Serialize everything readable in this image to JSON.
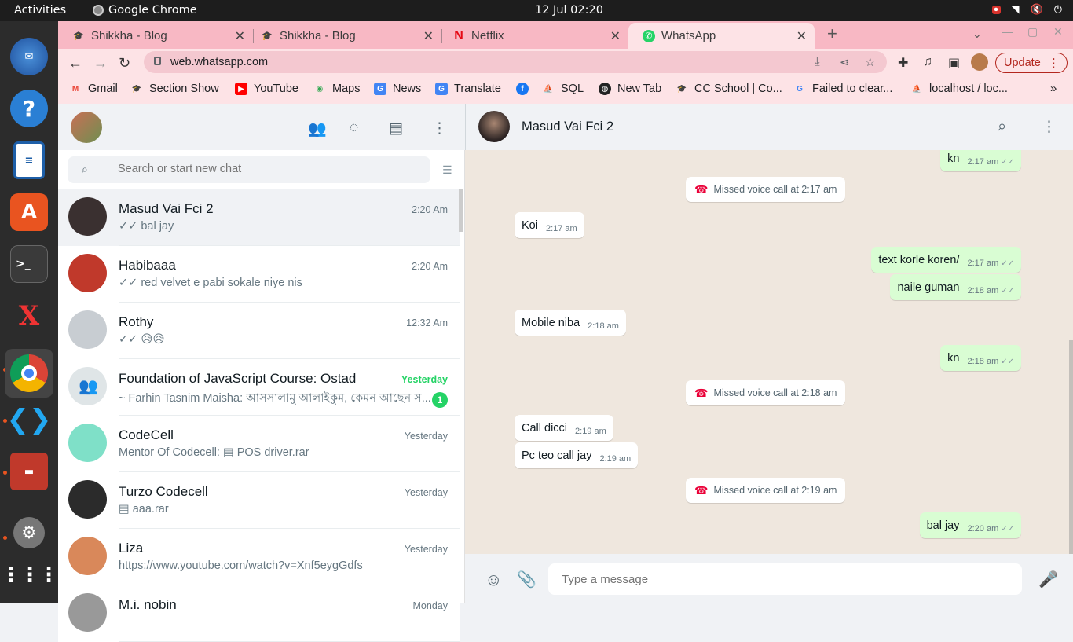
{
  "system": {
    "activities": "Activities",
    "app_name": "Google Chrome",
    "clock": "12 Jul  02:20"
  },
  "browser": {
    "tabs": [
      {
        "title": "Shikkha - Blog",
        "icon": "graduation-cap-icon"
      },
      {
        "title": "Shikkha - Blog",
        "icon": "graduation-cap-icon"
      },
      {
        "title": "Netflix",
        "icon": "netflix-icon"
      },
      {
        "title": "WhatsApp",
        "icon": "whatsapp-icon"
      }
    ],
    "url": "web.whatsapp.com",
    "update_label": "Update",
    "bookmarks": [
      {
        "label": "Gmail",
        "color": "#ea4335"
      },
      {
        "label": "Section Show",
        "color": "#222222"
      },
      {
        "label": "YouTube",
        "color": "#ff0000"
      },
      {
        "label": "Maps",
        "color": "#34a853"
      },
      {
        "label": "News",
        "color": "#4285f4"
      },
      {
        "label": "Translate",
        "color": "#4285f4"
      },
      {
        "label": "",
        "color": "#1877f2"
      },
      {
        "label": "SQL",
        "color": "#e8a317"
      },
      {
        "label": "New Tab",
        "color": "#222222"
      },
      {
        "label": "CC School | Co...",
        "color": "#222222"
      },
      {
        "label": "Failed to clear...",
        "color": "#4285f4"
      },
      {
        "label": "localhost / loc...",
        "color": "#e8a317"
      }
    ]
  },
  "whatsapp": {
    "search_placeholder": "Search or start new chat",
    "chats": [
      {
        "name": "Masud Vai Fci 2",
        "time": "2:20 Am",
        "preview": "✓✓ bal jay",
        "selected": true,
        "avatar_color": "#3a3030"
      },
      {
        "name": "Habibaaa",
        "time": "2:20 Am",
        "preview": "✓✓ red velvet e pabi sokale niye nis",
        "avatar_color": "#c0392b"
      },
      {
        "name": "Rothy",
        "time": "12:32 Am",
        "preview": "✓✓ 😥😥",
        "avatar_color": "#c8cdd2"
      },
      {
        "name": "Foundation of JavaScript Course: Ostad",
        "time": "Yesterday",
        "preview": "~ Farhin Tasnim Maisha: আসসালামু আলাইকুম, কেমন আছেন স...",
        "unread": "1",
        "avatar_color": "#dfe5e7"
      },
      {
        "name": "CodeCell",
        "time": "Yesterday",
        "preview": "Mentor Of Codecell: ▤ POS driver.rar",
        "avatar_color": "#7fe0c8"
      },
      {
        "name": "Turzo Codecell",
        "time": "Yesterday",
        "preview": "▤ aaa.rar",
        "avatar_color": "#2b2b2b"
      },
      {
        "name": "Liza",
        "time": "Yesterday",
        "preview": "https://www.youtube.com/watch?v=Xnf5eygGdfs",
        "avatar_color": "#d9885a"
      },
      {
        "name": "M.i. nobin",
        "time": "Monday",
        "preview": "",
        "avatar_color": "#999999"
      }
    ],
    "active_chat": {
      "name": "Masud Vai Fci 2",
      "messages": [
        {
          "type": "out",
          "text": "kn",
          "time": "2:17 am"
        },
        {
          "type": "sys",
          "text": "Missed voice call at 2:17 am"
        },
        {
          "type": "in",
          "text": "Koi",
          "time": "2:17 am"
        },
        {
          "type": "out",
          "text": "text korle koren/",
          "time": "2:17 am"
        },
        {
          "type": "out",
          "text": "naile guman",
          "time": "2:18 am"
        },
        {
          "type": "in",
          "text": "Mobile niba",
          "time": "2:18 am"
        },
        {
          "type": "out",
          "text": "kn",
          "time": "2:18 am"
        },
        {
          "type": "sys",
          "text": "Missed voice call at 2:18 am"
        },
        {
          "type": "in",
          "text": "Call dicci",
          "time": "2:19 am"
        },
        {
          "type": "in",
          "text": "Pc teo call jay",
          "time": "2:19 am"
        },
        {
          "type": "sys",
          "text": "Missed voice call at 2:19 am"
        },
        {
          "type": "out",
          "text": "bal jay",
          "time": "2:20 am"
        }
      ]
    },
    "compose_placeholder": "Type a message"
  }
}
